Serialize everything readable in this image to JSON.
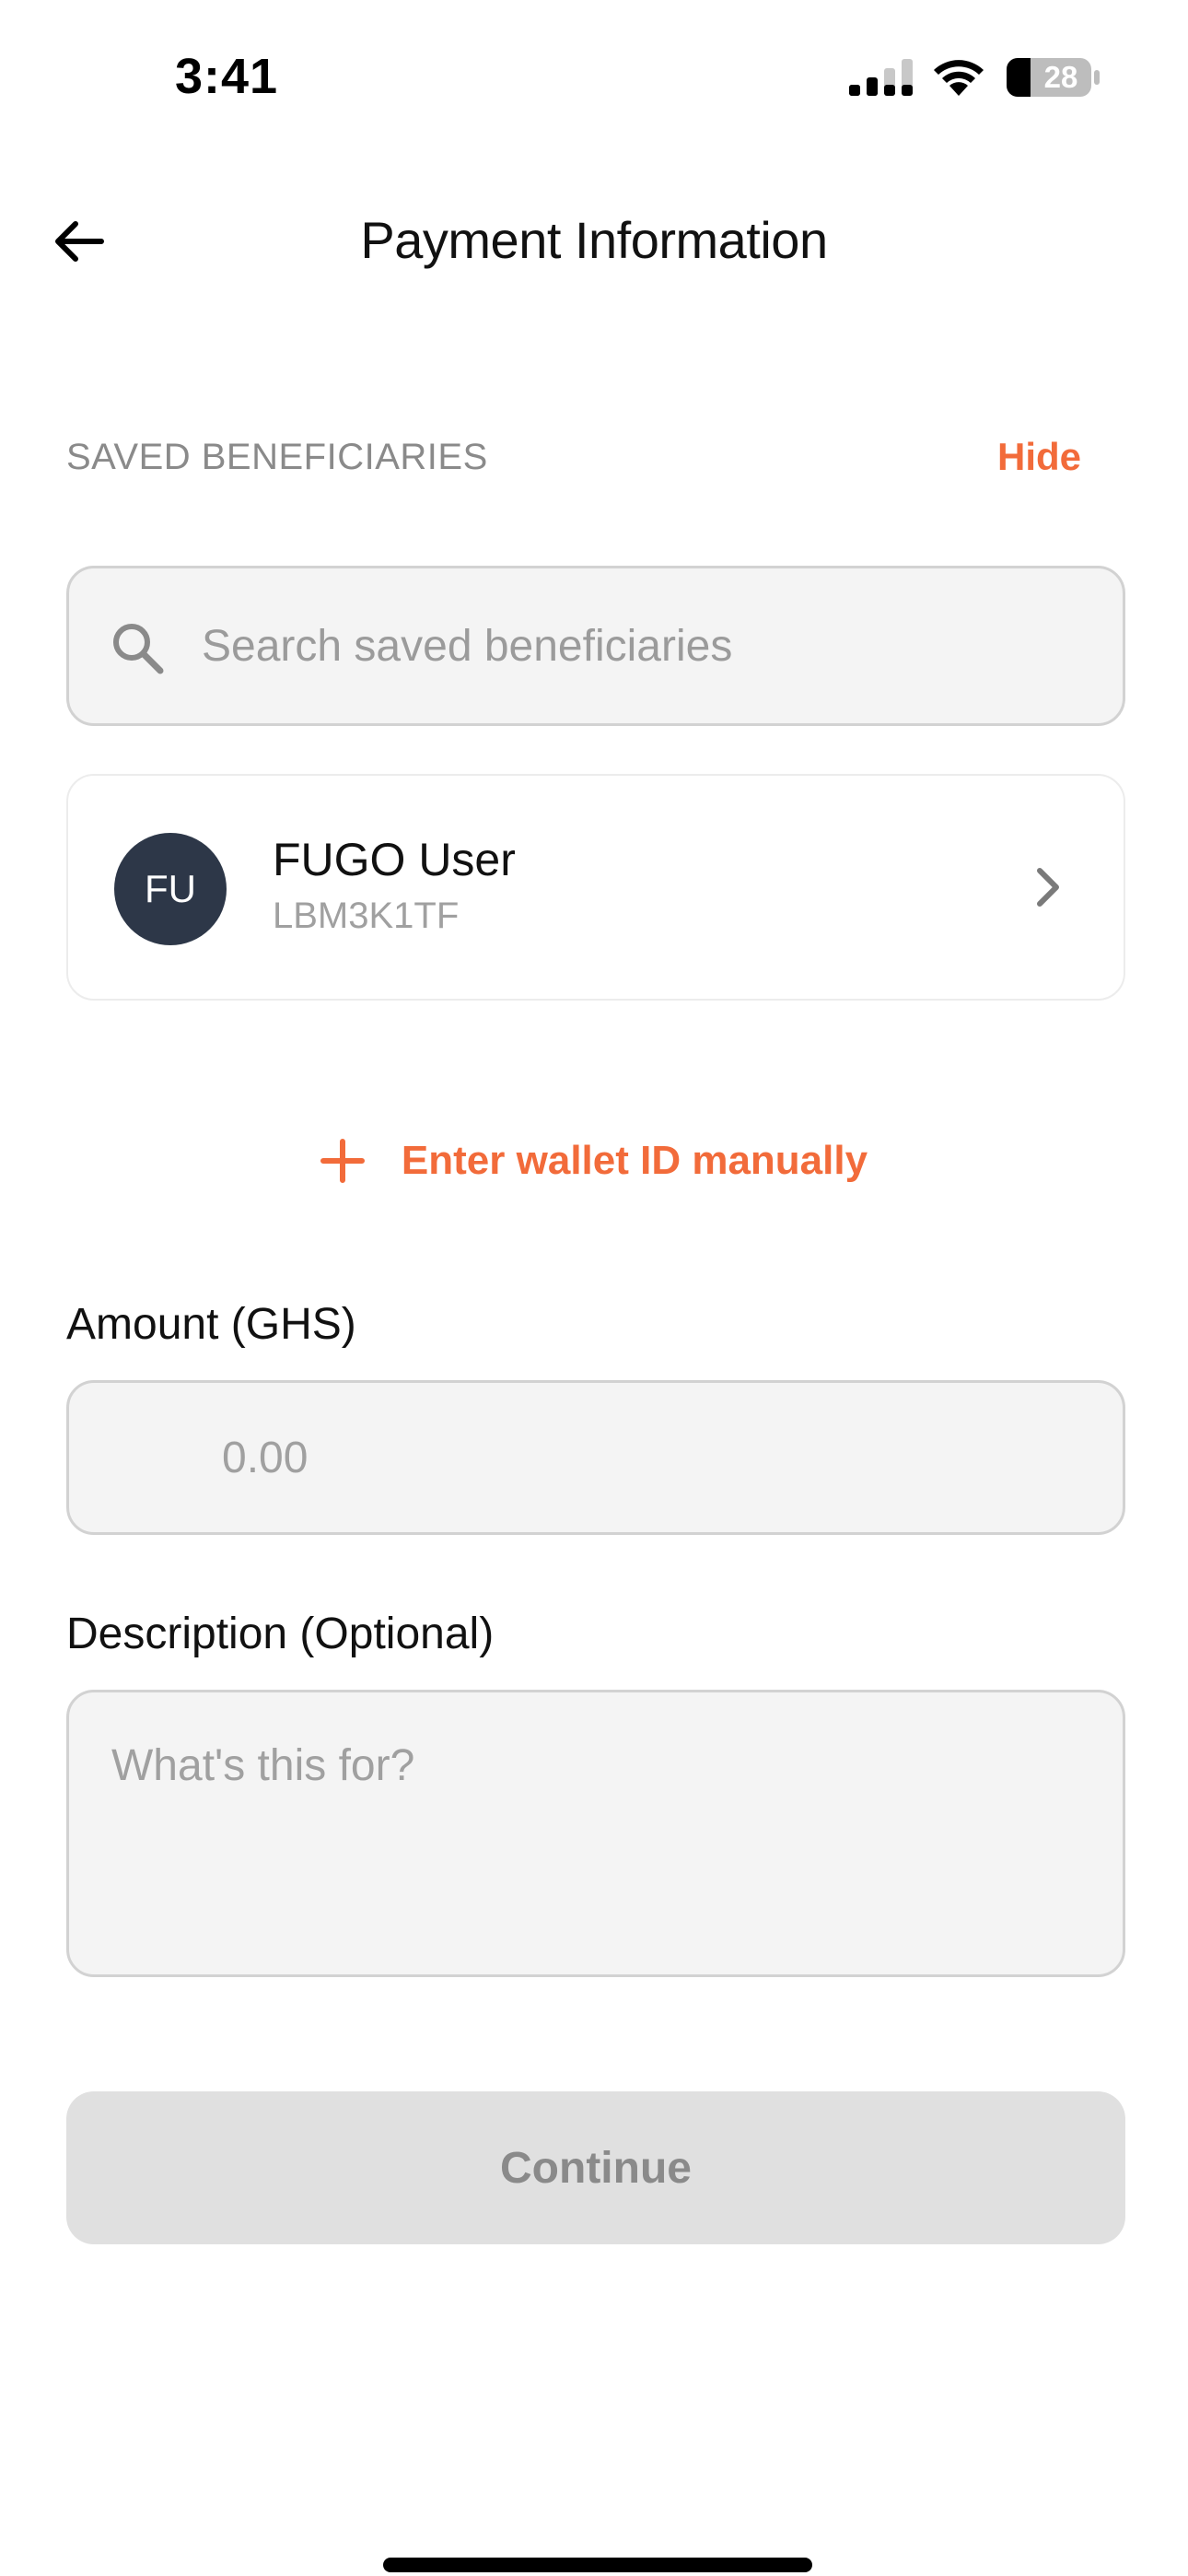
{
  "status_bar": {
    "time": "3:41",
    "battery_level": "28",
    "icons": [
      "signal-icon",
      "wifi-icon",
      "battery-icon"
    ]
  },
  "header": {
    "title": "Payment Information",
    "back_icon": "arrow-left-icon"
  },
  "beneficiaries": {
    "section_label": "SAVED BENEFICIARIES",
    "toggle_label": "Hide",
    "search_placeholder": "Search saved beneficiaries",
    "items": [
      {
        "initials": "FU",
        "name": "FUGO User",
        "wallet_id": "LBM3K1TF"
      }
    ]
  },
  "manual_entry": {
    "label": "Enter wallet ID manually",
    "icon": "plus-icon"
  },
  "form": {
    "amount_label": "Amount (GHS)",
    "amount_placeholder": "0.00",
    "description_label": "Description (Optional)",
    "description_placeholder": "What's this for?"
  },
  "actions": {
    "continue_label": "Continue"
  },
  "colors": {
    "accent": "#f26b3a",
    "avatar_bg": "#2d3748",
    "input_bg": "#f4f4f4",
    "disabled_button_bg": "#e0e0e0"
  }
}
